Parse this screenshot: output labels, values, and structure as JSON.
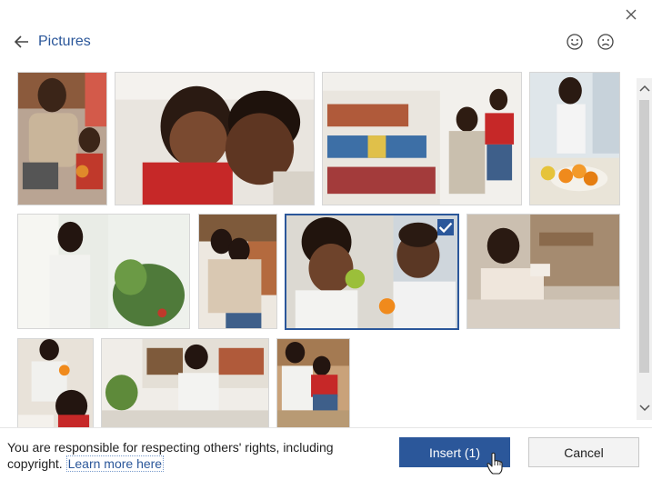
{
  "header": {
    "back_label": "Pictures",
    "back_icon": "arrow-left-icon",
    "close_icon": "close-icon",
    "smile_icon": "smile-icon",
    "frown_icon": "frown-icon"
  },
  "pictures": [
    {
      "name": "man-with-laptop-and-baby",
      "selected": false
    },
    {
      "name": "father-and-son-smiling",
      "selected": false
    },
    {
      "name": "family-at-bookshelf",
      "selected": false
    },
    {
      "name": "woman-in-kitchen-with-oranges",
      "selected": false
    },
    {
      "name": "woman-by-window-with-plants",
      "selected": false
    },
    {
      "name": "couple-hugging-by-bookshelf",
      "selected": false
    },
    {
      "name": "mother-and-baby-with-fruit",
      "selected": true
    },
    {
      "name": "woman-reading-on-sofa",
      "selected": false
    },
    {
      "name": "woman-with-baby-and-orange",
      "selected": false
    },
    {
      "name": "woman-writing-by-bookshelf",
      "selected": false
    },
    {
      "name": "mother-and-child-outdoors",
      "selected": false
    }
  ],
  "footer": {
    "notice_text": "You are responsible for respecting others' rights, including copyright.",
    "learn_more": "Learn more here",
    "insert_label": "Insert (1)",
    "cancel_label": "Cancel"
  },
  "colors": {
    "accent": "#2b579a"
  }
}
